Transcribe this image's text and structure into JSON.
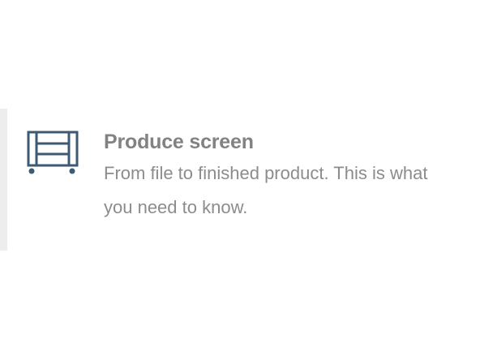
{
  "card": {
    "title": "Produce screen",
    "description": "From file to finished product. This is what you need to know.",
    "icon": "film-cart-icon",
    "icon_color": "#3d5a72",
    "title_color": "#828282",
    "text_color": "#8c8c8c"
  }
}
